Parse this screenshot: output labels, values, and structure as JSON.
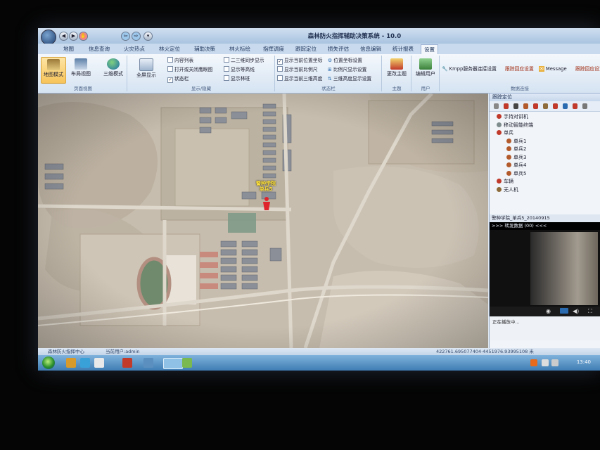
{
  "window": {
    "title": "森林防火指挥辅助决策系统 - 10.0"
  },
  "ribbon_tabs": [
    "地图",
    "信息查询",
    "火灾热点",
    "林火定位",
    "辅助决策",
    "林火标绘",
    "指挥调度",
    "跟踪定位",
    "损失评估",
    "信息编辑",
    "统计报表",
    "设置"
  ],
  "active_tab": "设置",
  "ribbon": {
    "view_group": {
      "label": "页面视图",
      "buttons": [
        "地图模式",
        "布局视图",
        "三维模式"
      ],
      "selected": "地图模式"
    },
    "display_group": {
      "label": "显示/隐藏",
      "fullscreen": "全屏显示",
      "checks": [
        {
          "label": "内容列表",
          "checked": false
        },
        {
          "label": "打开或关闭鹰眼图",
          "checked": false
        },
        {
          "label": "状态栏",
          "checked": true
        },
        {
          "label": "二三维同步显示",
          "checked": false
        },
        {
          "label": "显示等高线",
          "checked": false
        },
        {
          "label": "显示林班",
          "checked": false
        }
      ]
    },
    "statusbar_group": {
      "label": "状态栏",
      "checks": [
        {
          "label": "显示当前位置坐标",
          "checked": true
        },
        {
          "label": "显示当前比例尺",
          "checked": false
        },
        {
          "label": "显示当前三维高度",
          "checked": false
        },
        {
          "label": "位置坐标设置",
          "checked": false
        },
        {
          "label": "比例尺显示设置",
          "checked": false
        },
        {
          "label": "三维高度显示设置",
          "checked": false
        }
      ]
    },
    "theme_group": {
      "label": "主题",
      "button": "更改主题"
    },
    "user_group": {
      "label": "用户",
      "button": "编辑用户"
    },
    "connection_group": {
      "label": "数据连接",
      "kmpp": "Kmpp服务器连接设置",
      "track": "跟踪回应设置",
      "message": "Message",
      "extra": "跟踪回应设置"
    }
  },
  "map": {
    "marker_label_line1": "警种学院",
    "marker_label_line2": "单兵5"
  },
  "side_panel": {
    "title": "跟踪定位",
    "tree": [
      {
        "label": "手持对讲机",
        "level": 1,
        "icon": "radio-icon",
        "color": "#c0392b"
      },
      {
        "label": "移动智能终端",
        "level": 1,
        "icon": "mobile-icon",
        "color": "#7f8c8d"
      },
      {
        "label": "单兵",
        "level": 0,
        "icon": "soldier-group-icon",
        "color": "#c0392b"
      },
      {
        "label": "单兵1",
        "level": 2,
        "icon": "person-icon",
        "color": "#b35a2d"
      },
      {
        "label": "单兵2",
        "level": 2,
        "icon": "person-icon",
        "color": "#b35a2d"
      },
      {
        "label": "单兵3",
        "level": 2,
        "icon": "person-icon",
        "color": "#b35a2d"
      },
      {
        "label": "单兵4",
        "level": 2,
        "icon": "person-icon",
        "color": "#b35a2d"
      },
      {
        "label": "单兵5",
        "level": 2,
        "icon": "person-icon",
        "color": "#b35a2d"
      },
      {
        "label": "车辆",
        "level": 1,
        "icon": "vehicle-icon",
        "color": "#c0392b"
      },
      {
        "label": "无人机",
        "level": 1,
        "icon": "drone-icon",
        "color": "#8e6b3a"
      }
    ],
    "video_title": "警种学院_单兵5_20140915",
    "video_status": ">>> 转发数据 (00) <<<",
    "video_foot": "正在播放中..."
  },
  "status_bar": {
    "app_name": "森林防火指挥中心",
    "user": "当前用户:admin",
    "coords": "422761.695077404·4451976.93995108 米"
  },
  "taskbar": {
    "time": "13:40"
  },
  "colors": {
    "accent": "#f7c45a",
    "marker": "#e0242b",
    "label_yellow": "#ffe23a"
  }
}
